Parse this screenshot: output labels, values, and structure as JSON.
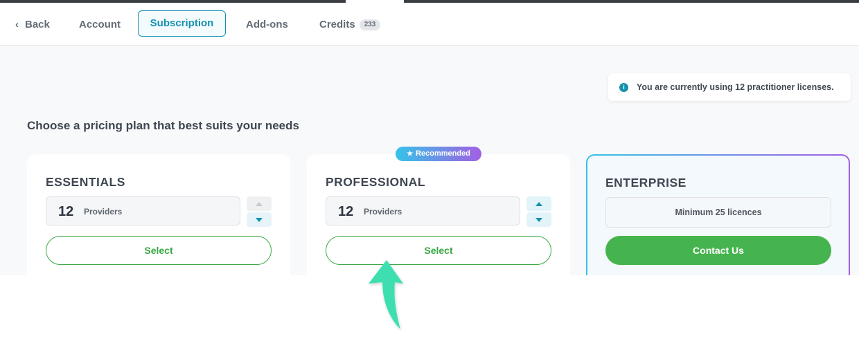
{
  "nav": {
    "back_label": "Back",
    "tabs": [
      {
        "label": "Account"
      },
      {
        "label": "Subscription",
        "active": true
      },
      {
        "label": "Add-ons"
      },
      {
        "label": "Credits",
        "badge": "233"
      }
    ]
  },
  "notice": {
    "icon": "info-icon",
    "text": "You are currently using 12 practitioner licenses."
  },
  "heading": "Choose a pricing plan that best suits your needs",
  "plans": [
    {
      "title": "ESSENTIALS",
      "quantity": "12",
      "unit": "Providers",
      "button_label": "Select"
    },
    {
      "title": "PROFESSIONAL",
      "badge": "Recommended",
      "quantity": "12",
      "unit": "Providers",
      "button_label": "Select"
    },
    {
      "title": "ENTERPRISE",
      "minimum": "Minimum 25 licences",
      "button_label": "Contact Us"
    }
  ],
  "colors": {
    "accent": "#1591b0",
    "primary_green": "#46b44e",
    "gradient_start": "#35c3e8",
    "gradient_end": "#a35fe3",
    "arrow": "#3ddfb0"
  }
}
